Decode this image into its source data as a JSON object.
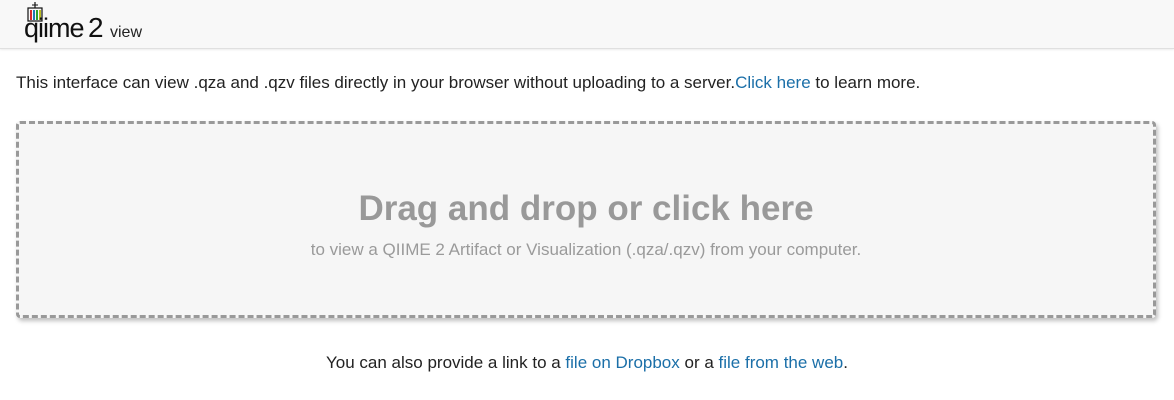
{
  "header": {
    "logo_qiime": "qiime",
    "logo_two": "2",
    "logo_view": "view",
    "brand_colors": [
      "#d62728",
      "#1f77b4",
      "#2ca02c",
      "#bcbd22"
    ]
  },
  "intro": {
    "text": "This interface can view .qza and .qzv files directly in your browser without uploading to a server.",
    "link_label": "Click here",
    "suffix": " to learn more.",
    "link_color": "#1b6fa8"
  },
  "dropzone": {
    "title": "Drag and drop or click here",
    "subtitle": "to view a QIIME 2 Artifact or Visualization (.qza/.qzv) from your computer.",
    "title_color": "#999999",
    "border_color": "#999999",
    "background": "#f6f6f6"
  },
  "footer": {
    "prefix": "You can also provide a link to a ",
    "dropbox_link": "file on Dropbox",
    "middle": " or a ",
    "web_link": "file from the web",
    "suffix": "."
  }
}
